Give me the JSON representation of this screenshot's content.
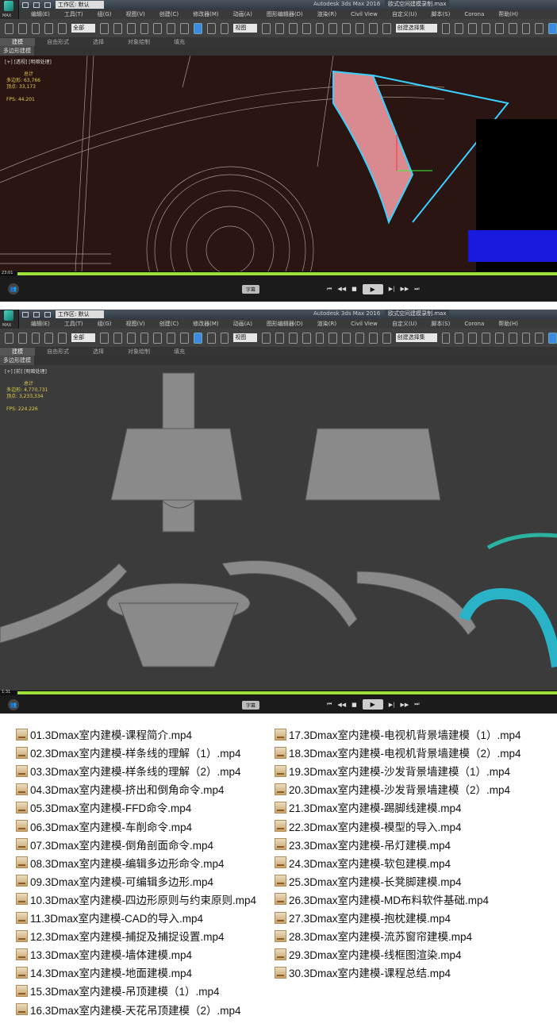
{
  "app": {
    "title": "Autodesk 3ds Max 2016",
    "file": "欧式空间建模录制.max",
    "workspace": "工作区: 默认",
    "logo": "MAX",
    "menu": [
      "编辑(E)",
      "工具(T)",
      "组(G)",
      "视图(V)",
      "创建(C)",
      "修改器(M)",
      "动画(A)",
      "图形编辑器(D)",
      "渲染(R)",
      "Civil View",
      "自定义(U)",
      "脚本(S)",
      "Corona",
      "帮助(H)"
    ],
    "filter": "全部",
    "refcoord": "视图",
    "selset": "创建选择集",
    "ribbon_tabs": [
      "建模",
      "自由形式",
      "选择",
      "对象绘制",
      "填充"
    ],
    "ribbon_sub": "多边形建模"
  },
  "views": [
    {
      "label": "[+] [透视] [明暗处理]",
      "stats_header": "总计",
      "poly_label": "多边形:",
      "poly": "63,766",
      "vert_label": "顶点:",
      "vert": "33,173",
      "fps_label": "FPS:",
      "fps": "44.201",
      "time": "23:01",
      "progress": 1.0
    },
    {
      "label": "[+] [前] [明暗处理]",
      "stats_header": "总计",
      "poly_label": "多边形:",
      "poly": "4,770,731",
      "vert_label": "顶点:",
      "vert": "3,233,334",
      "fps_label": "FPS:",
      "fps": "224.226",
      "time": "1:31",
      "progress": 1.0
    }
  ],
  "player": {
    "subtitle_btn": "字幕",
    "buttons": [
      "⏮",
      "◀◀",
      "■",
      "▶",
      "▶|",
      "▶▶",
      "⏭"
    ]
  },
  "files_left": [
    "01.3Dmax室内建模-课程简介.mp4",
    "02.3Dmax室内建模-样条线的理解（1）.mp4",
    "03.3Dmax室内建模-样条线的理解（2）.mp4",
    "04.3Dmax室内建模-挤出和倒角命令.mp4",
    "05.3Dmax室内建模-FFD命令.mp4",
    "06.3Dmax室内建模-车削命令.mp4",
    "07.3Dmax室内建模-倒角剖面命令.mp4",
    "08.3Dmax室内建模-编辑多边形命令.mp4",
    "09.3Dmax室内建模-可编辑多边形.mp4",
    "10.3Dmax室内建模-四边形原则与约束原则.mp4",
    "11.3Dmax室内建模-CAD的导入.mp4",
    "12.3Dmax室内建模-捕捉及捕捉设置.mp4",
    "13.3Dmax室内建模-墙体建模.mp4",
    "14.3Dmax室内建模-地面建模.mp4",
    "15.3Dmax室内建模-吊顶建模（1）.mp4",
    "16.3Dmax室内建模-天花吊顶建模（2）.mp4"
  ],
  "files_right": [
    "17.3Dmax室内建模-电视机背景墙建模（1）.mp4",
    "18.3Dmax室内建模-电视机背景墙建模（2）.mp4",
    "19.3Dmax室内建模-沙发背景墙建模（1）.mp4",
    "20.3Dmax室内建模-沙发背景墙建模（2）.mp4",
    "21.3Dmax室内建模-踢脚线建模.mp4",
    "22.3Dmax室内建模-模型的导入.mp4",
    "23.3Dmax室内建模-吊灯建模.mp4",
    "24.3Dmax室内建模-软包建模.mp4",
    "25.3Dmax室内建模-长凳脚建模.mp4",
    "26.3Dmax室内建模-MD布料软件基础.mp4",
    "27.3Dmax室内建模-抱枕建模.mp4",
    "28.3Dmax室内建模-流苏窗帘建模.mp4",
    "29.3Dmax室内建模-线框图渲染.mp4",
    "30.3Dmax室内建模-课程总结.mp4"
  ],
  "colors": {
    "progress": "#9ee03a",
    "stats": "#e3d24a",
    "viewport1": "#2a1512",
    "viewport2": "#3a3a3a"
  }
}
